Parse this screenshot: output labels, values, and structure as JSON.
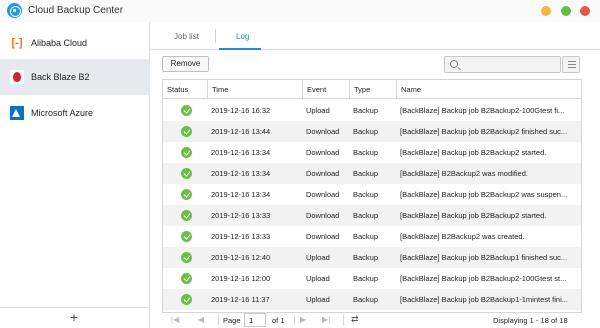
{
  "app": {
    "title": "Cloud Backup Center",
    "icon": "cloud-backup-icon"
  },
  "window_controls": [
    {
      "name": "minimize",
      "color": "#f1b641"
    },
    {
      "name": "maximize",
      "color": "#5fbd4a"
    },
    {
      "name": "close",
      "color": "#e5574d"
    }
  ],
  "sidebar": {
    "items": [
      {
        "label": "Alibaba Cloud",
        "icon": "alibaba-cloud-icon",
        "active": false
      },
      {
        "label": "Back Blaze B2",
        "icon": "backblaze-icon",
        "active": true
      },
      {
        "label": "Microsoft Azure",
        "icon": "azure-icon",
        "active": false
      }
    ],
    "add_label": "+"
  },
  "tabs": [
    {
      "label": "Job list",
      "active": false
    },
    {
      "label": "Log",
      "active": true
    }
  ],
  "toolbar": {
    "remove_label": "Remove",
    "search_placeholder": ""
  },
  "table": {
    "columns": [
      "Status",
      "Time",
      "Event",
      "Type",
      "Name"
    ],
    "rows": [
      {
        "status": "success",
        "time": "2019-12-16 16:32",
        "event": "Upload",
        "type": "Backup",
        "name": "[BackBlaze] Backup job B2Backup2-100Gtest fi..."
      },
      {
        "status": "success",
        "time": "2019-12-16 13:44",
        "event": "Download",
        "type": "Backup",
        "name": "[BackBlaze] Backup job B2Backup2 finished suc..."
      },
      {
        "status": "success",
        "time": "2019-12-16 13:34",
        "event": "Download",
        "type": "Backup",
        "name": "[BackBlaze] Backup job B2Backup2 started."
      },
      {
        "status": "success",
        "time": "2019-12-16 13:34",
        "event": "Download",
        "type": "Backup",
        "name": "[BackBlaze] B2Backup2 was modified."
      },
      {
        "status": "success",
        "time": "2019-12-16 13:34",
        "event": "Download",
        "type": "Backup",
        "name": "[BackBlaze] Backup job B2Backup2 was suspen..."
      },
      {
        "status": "success",
        "time": "2019-12-16 13:33",
        "event": "Download",
        "type": "Backup",
        "name": "[BackBlaze] Backup job B2Backup2 started."
      },
      {
        "status": "success",
        "time": "2019-12-16 13:33",
        "event": "Download",
        "type": "Backup",
        "name": "[BackBlaze] B2Backup2 was created."
      },
      {
        "status": "success",
        "time": "2019-12-16 12:40",
        "event": "Upload",
        "type": "Backup",
        "name": "[BackBlaze] Backup job B2Backup1 finished suc..."
      },
      {
        "status": "success",
        "time": "2019-12-16 12:00",
        "event": "Upload",
        "type": "Backup",
        "name": "[BackBlaze] Backup job B2Backup2-100Gtest st..."
      },
      {
        "status": "success",
        "time": "2019-12-16 11:37",
        "event": "Upload",
        "type": "Backup",
        "name": "[BackBlaze] Backup job B2Backup1-1mintest fini..."
      }
    ]
  },
  "pager": {
    "page_label": "Page",
    "page_value": "1",
    "of_label": "of 1",
    "info": "Displaying 1 - 18 of 18"
  },
  "colors": {
    "accent": "#1f8ed6",
    "success": "#6cbf45",
    "sidebar_active": "#e6eaef"
  }
}
